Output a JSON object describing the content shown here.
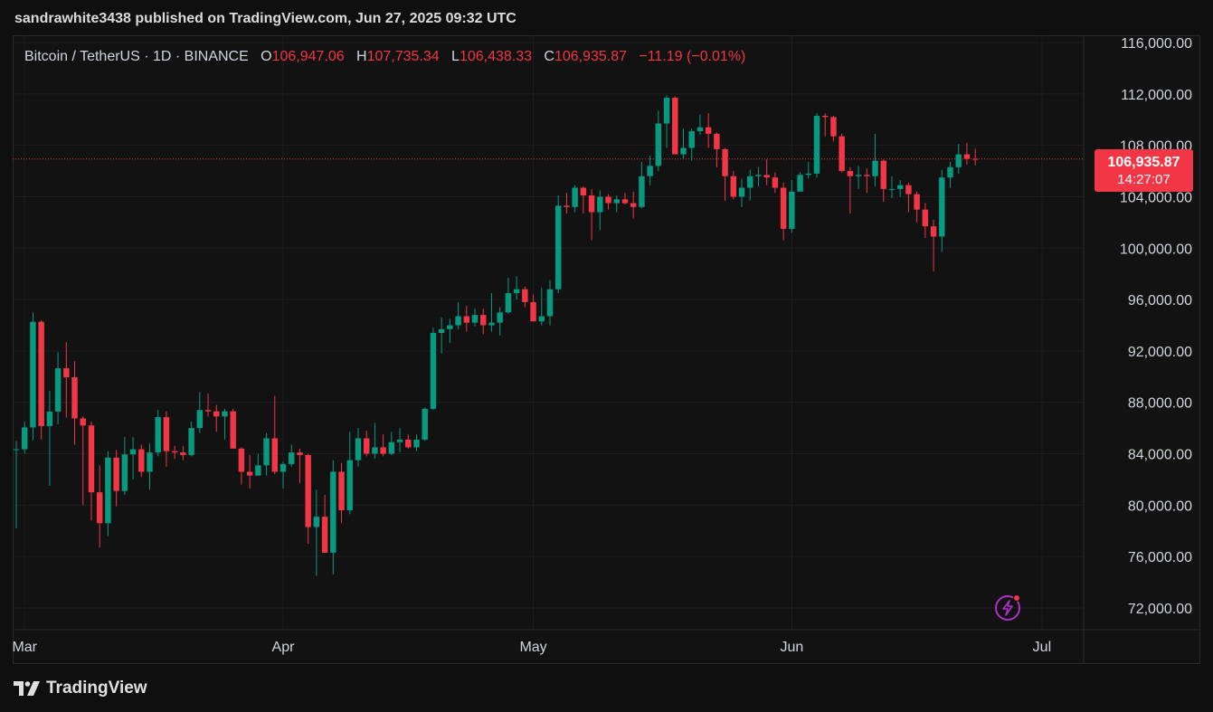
{
  "header": {
    "text": "sandrawhite3438 published on TradingView.com, Jun 27, 2025 09:32 UTC"
  },
  "legend": {
    "symbol": "Bitcoin / TetherUS · 1D · BINANCE",
    "open_label": "O",
    "open": "106,947.06",
    "high_label": "H",
    "high": "107,735.34",
    "low_label": "L",
    "low": "106,438.33",
    "close_label": "C",
    "close": "106,935.87",
    "change": "−11.19 (−0.01%)"
  },
  "price_tag": {
    "price": "106,935.87",
    "countdown": "14:27:07"
  },
  "footer": {
    "brand": "TradingView"
  },
  "colors": {
    "up": "#089981",
    "down": "#f23645",
    "grid": "#1e1e1e",
    "text": "#d1d4dc",
    "background": "#121212"
  },
  "icons": {
    "flash": "lightning-icon",
    "logo": "tradingview-logo-icon"
  },
  "chart_data": {
    "type": "candlestick",
    "y_axis": {
      "ticks": [
        72000,
        76000,
        80000,
        84000,
        88000,
        92000,
        96000,
        100000,
        104000,
        108000,
        112000,
        116000
      ],
      "tick_labels": [
        "72,000.00",
        "76,000.00",
        "80,000.00",
        "84,000.00",
        "88,000.00",
        "92,000.00",
        "96,000.00",
        "100,000.00",
        "104,000.00",
        "108,000.00",
        "112,000.00",
        "116,000.00"
      ],
      "range": [
        70000,
        117000
      ],
      "position": "right"
    },
    "x_axis": {
      "ticks": [
        "2025-03-01",
        "2025-04-01",
        "2025-05-01",
        "2025-06-01",
        "2025-07-01"
      ],
      "tick_labels": [
        "Mar",
        "Apr",
        "May",
        "Jun",
        "Jul"
      ],
      "range": [
        "2025-02-28",
        "2025-07-06"
      ]
    },
    "grid": true,
    "last_price_line": 106935.87,
    "first_date": "2025-02-28",
    "candles": [
      [
        84350,
        85000,
        78200,
        84350
      ],
      [
        84350,
        86500,
        84000,
        86050
      ],
      [
        86050,
        95000,
        85050,
        94270
      ],
      [
        94270,
        94400,
        85100,
        86150
      ],
      [
        86150,
        88900,
        81500,
        87280
      ],
      [
        87280,
        91900,
        86300,
        90650
      ],
      [
        90650,
        92700,
        86800,
        89950
      ],
      [
        89950,
        91200,
        84700,
        86750
      ],
      [
        86750,
        86900,
        80000,
        86200
      ],
      [
        86200,
        86500,
        78800,
        81000
      ],
      [
        81000,
        83100,
        76700,
        78600
      ],
      [
        78600,
        84200,
        77600,
        83700
      ],
      [
        83700,
        84300,
        79900,
        81100
      ],
      [
        81100,
        85300,
        80800,
        83950
      ],
      [
        83950,
        85300,
        82000,
        84350
      ],
      [
        84350,
        84700,
        82200,
        82600
      ],
      [
        82600,
        84800,
        81200,
        84100
      ],
      [
        84100,
        87400,
        83800,
        86850
      ],
      [
        86850,
        87300,
        83000,
        84200
      ],
      [
        84200,
        84600,
        83600,
        84100
      ],
      [
        84100,
        84600,
        83500,
        83900
      ],
      [
        83900,
        86500,
        83800,
        86000
      ],
      [
        86000,
        88800,
        85600,
        87400
      ],
      [
        87400,
        88700,
        86900,
        87300
      ],
      [
        87300,
        87800,
        85700,
        86900
      ],
      [
        86900,
        87500,
        85100,
        87300
      ],
      [
        87300,
        87500,
        84800,
        84400
      ],
      [
        84400,
        84500,
        81600,
        82600
      ],
      [
        82600,
        83900,
        81300,
        82300
      ],
      [
        82300,
        84000,
        82300,
        83100
      ],
      [
        83100,
        85600,
        82300,
        85200
      ],
      [
        85200,
        88500,
        82400,
        82600
      ],
      [
        82600,
        83400,
        81300,
        83200
      ],
      [
        83200,
        84700,
        83000,
        84100
      ],
      [
        84100,
        84400,
        81700,
        83900
      ],
      [
        83900,
        84000,
        77000,
        78300
      ],
      [
        78300,
        81200,
        74500,
        79100
      ],
      [
        79100,
        80800,
        76300,
        76300
      ],
      [
        76300,
        83500,
        74600,
        82600
      ],
      [
        82600,
        83300,
        78600,
        79600
      ],
      [
        79600,
        85700,
        79300,
        83500
      ],
      [
        83500,
        86000,
        83000,
        85200
      ],
      [
        85200,
        85800,
        83800,
        84000
      ],
      [
        84000,
        86400,
        83600,
        84500
      ],
      [
        84500,
        85500,
        83800,
        84000
      ],
      [
        84000,
        85700,
        83900,
        84900
      ],
      [
        84900,
        86000,
        84100,
        85100
      ],
      [
        85100,
        85500,
        84400,
        84500
      ],
      [
        84500,
        85500,
        84200,
        85100
      ],
      [
        85100,
        87600,
        85000,
        87500
      ],
      [
        87500,
        93800,
        87400,
        93400
      ],
      [
        93400,
        94600,
        91800,
        93700
      ],
      [
        93700,
        94500,
        92600,
        94000
      ],
      [
        94000,
        95800,
        93700,
        94700
      ],
      [
        94700,
        95500,
        93500,
        94200
      ],
      [
        94200,
        95300,
        93900,
        94800
      ],
      [
        94800,
        95300,
        93300,
        94000
      ],
      [
        94000,
        96500,
        93500,
        94200
      ],
      [
        94200,
        95400,
        93200,
        95000
      ],
      [
        95000,
        97700,
        94900,
        96500
      ],
      [
        96500,
        97800,
        96000,
        96800
      ],
      [
        96800,
        97000,
        95400,
        95800
      ],
      [
        95800,
        96400,
        94500,
        94300
      ],
      [
        94300,
        96900,
        94000,
        94700
      ],
      [
        94700,
        97500,
        94000,
        96800
      ],
      [
        96800,
        104100,
        96500,
        103300
      ],
      [
        103300,
        104300,
        102700,
        103200
      ],
      [
        103200,
        104900,
        102800,
        104700
      ],
      [
        104700,
        104800,
        102700,
        104100
      ],
      [
        104100,
        104600,
        100600,
        102800
      ],
      [
        102800,
        104500,
        101400,
        104000
      ],
      [
        104000,
        104200,
        103000,
        103500
      ],
      [
        103500,
        104100,
        102800,
        103800
      ],
      [
        103800,
        104300,
        103400,
        103500
      ],
      [
        103500,
        104400,
        102300,
        103200
      ],
      [
        103200,
        106700,
        103100,
        105600
      ],
      [
        105600,
        107200,
        104900,
        106400
      ],
      [
        106400,
        110700,
        106000,
        109700
      ],
      [
        109700,
        111900,
        107800,
        111700
      ],
      [
        111700,
        111800,
        107400,
        107300
      ],
      [
        107300,
        109300,
        106900,
        107800
      ],
      [
        107800,
        109300,
        106800,
        109100
      ],
      [
        109100,
        110400,
        108800,
        109400
      ],
      [
        109400,
        110500,
        107800,
        108900
      ],
      [
        108900,
        109000,
        106300,
        107700
      ],
      [
        107700,
        107800,
        103700,
        105600
      ],
      [
        105600,
        106000,
        103800,
        104000
      ],
      [
        104000,
        105400,
        103200,
        104700
      ],
      [
        104700,
        106100,
        103700,
        105600
      ],
      [
        105600,
        106300,
        104800,
        105700
      ],
      [
        105700,
        106900,
        104900,
        105500
      ],
      [
        105500,
        105900,
        104300,
        104700
      ],
      [
        104700,
        105100,
        100600,
        101500
      ],
      [
        101500,
        105300,
        101200,
        104400
      ],
      [
        104400,
        105900,
        104400,
        105700
      ],
      [
        105700,
        106700,
        105400,
        105800
      ],
      [
        105800,
        110500,
        105500,
        110300
      ],
      [
        110300,
        110500,
        108700,
        110200
      ],
      [
        110200,
        110300,
        108300,
        108700
      ],
      [
        108700,
        108900,
        105900,
        106000
      ],
      [
        106000,
        106300,
        102700,
        105600
      ],
      [
        105600,
        106400,
        104600,
        105700
      ],
      [
        105700,
        106200,
        104300,
        105600
      ],
      [
        105600,
        108900,
        104800,
        106800
      ],
      [
        106800,
        106900,
        103600,
        104600
      ],
      [
        104600,
        105600,
        103900,
        104600
      ],
      [
        104600,
        105300,
        104000,
        104900
      ],
      [
        104900,
        105100,
        102800,
        104200
      ],
      [
        104200,
        104400,
        102000,
        103000
      ],
      [
        103000,
        103500,
        100800,
        101700
      ],
      [
        101700,
        102200,
        98200,
        100900
      ],
      [
        100900,
        106100,
        99700,
        105500
      ],
      [
        105500,
        106700,
        104700,
        106300
      ],
      [
        106300,
        108100,
        105800,
        107300
      ],
      [
        107300,
        108200,
        106500,
        106950
      ],
      [
        106950,
        107735,
        106438,
        106936
      ]
    ]
  }
}
